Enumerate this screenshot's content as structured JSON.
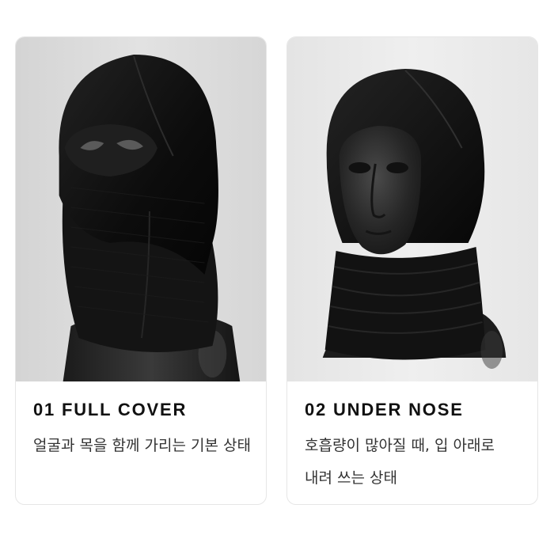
{
  "cards": [
    {
      "title": "01 FULL COVER",
      "description": "얼굴과 목을 함께 가리는 기본 상태",
      "image": "balaclava-full-cover-photo"
    },
    {
      "title": "02 UNDER NOSE",
      "description": "호흡량이 많아질 때, 입 아래로 내려 쓰는 상태",
      "image": "balaclava-under-nose-photo"
    }
  ],
  "colors": {
    "photo_bg_1": "#d9d9d9",
    "photo_bg_2": "#e9e9e9",
    "fabric": "#101010",
    "mannequin": "#262626",
    "card_border": "#e6e6e6"
  }
}
